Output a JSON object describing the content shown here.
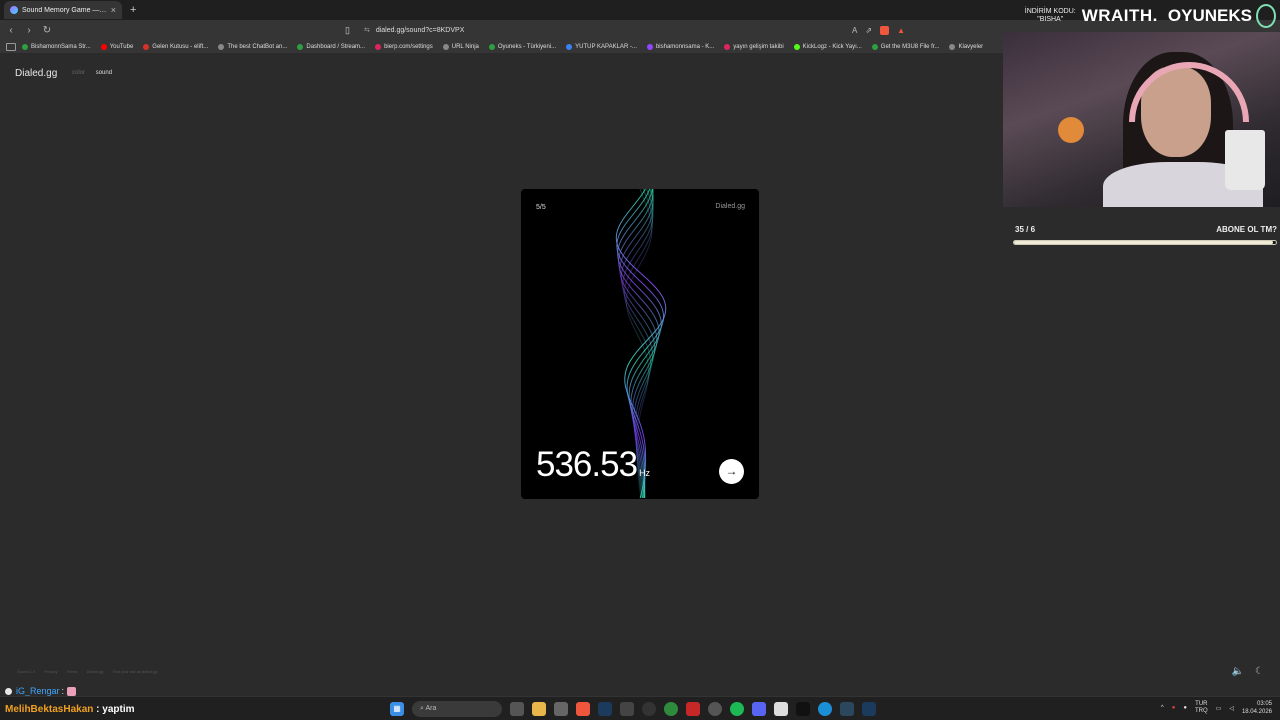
{
  "browser": {
    "tab_title": "Sound Memory Game — Ho",
    "tab_close": "×",
    "new_tab": "+",
    "nav_back": "‹",
    "nav_forward": "›",
    "nav_reload": "↻",
    "url": "dialed.gg/sound?c=8KDVPX",
    "bookmarks": [
      {
        "label": "BishamonnSama Str...",
        "color": "#2ea043"
      },
      {
        "label": "YouTube",
        "color": "#ff0000"
      },
      {
        "label": "Gelen Kutusu - elift...",
        "color": "#d93025"
      },
      {
        "label": "The best ChatBot an...",
        "color": "#888888"
      },
      {
        "label": "Dashboard / Stream...",
        "color": "#2ea043"
      },
      {
        "label": "bierp.com/settings",
        "color": "#e0245e"
      },
      {
        "label": "URL Ninja",
        "color": "#888888"
      },
      {
        "label": "Oyuneks - Türkiyeni...",
        "color": "#2ea043"
      },
      {
        "label": "YUTUP KAPAKLAR -...",
        "color": "#3b82f6"
      },
      {
        "label": "bishamonnsama - K...",
        "color": "#9147ff"
      },
      {
        "label": "yayın gelişim takibi",
        "color": "#e0245e"
      },
      {
        "label": "KickLogz - Kick Yayı...",
        "color": "#53fc18"
      },
      {
        "label": "Get the M3U8 File fr...",
        "color": "#2ea043"
      },
      {
        "label": "Klavyeler",
        "color": "#888888"
      }
    ]
  },
  "page": {
    "brand": "Dialed.gg",
    "nav": [
      "color",
      "sound"
    ],
    "active_nav": "sound",
    "card": {
      "round": "5/5",
      "brand": "Dialed.gg",
      "frequency": "536.53",
      "unit": "Hz",
      "next_icon": "→"
    },
    "footer": [
      "Sound 1.0",
      "Privacy",
      "Terms",
      "Dialed.gg",
      "Test your ear at dialed.gg"
    ],
    "icons": [
      "volume-icon",
      "moon-icon"
    ]
  },
  "overlay": {
    "code_line1": "İNDİRİM KODU:",
    "code_line2": "\"BISHA\"",
    "wraith": "WRAITH.",
    "logo": "OYUNEKS",
    "goal_count": "35 / 6",
    "goal_text": "ABONE OL TM?",
    "goal_progress": 0.99
  },
  "chat": [
    {
      "user": "iG_Rengar",
      "message": ":"
    },
    {
      "user": "MelihBektasHakan",
      "message": ": yaptim"
    }
  ],
  "taskbar": {
    "search_placeholder": "Ara",
    "lang_top": "TUR",
    "lang_bottom": "TRQ",
    "time": "03:05",
    "date": "18.04.2026"
  }
}
